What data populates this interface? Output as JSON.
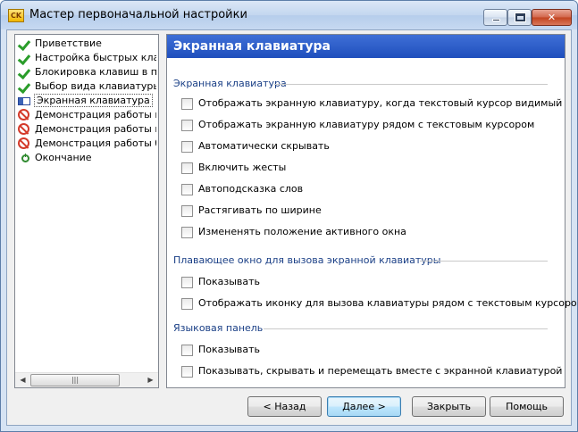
{
  "window": {
    "title": "Мастер первоначальной настройки",
    "icon_text": "CK"
  },
  "nav": {
    "items": [
      {
        "label": "Приветствие",
        "status": "check-icon"
      },
      {
        "label": "Настройка быстрых клавиш",
        "status": "check-icon"
      },
      {
        "label": "Блокировка клавиш в полноэкранных",
        "status": "check-icon"
      },
      {
        "label": "Выбор вида клавиатуры",
        "status": "check-icon"
      },
      {
        "label": "Экранная клавиатура",
        "status": "flag-icon",
        "selected": true
      },
      {
        "label": "Демонстрация работы переключения",
        "status": "no-entry-icon"
      },
      {
        "label": "Демонстрация работы шаблонов",
        "status": "no-entry-icon"
      },
      {
        "label": "Демонстрация работы буфера",
        "status": "no-entry-icon"
      },
      {
        "label": "Окончание",
        "status": "clock-icon"
      }
    ],
    "scroll_grip": "|||"
  },
  "page": {
    "header": "Экранная клавиатура",
    "groups": [
      {
        "title": "Экранная клавиатура",
        "options": [
          "Отображать экранную клавиатуру, когда текстовый курсор видимый",
          "Отображать экранную клавиатуру рядом с текстовым курсором",
          "Автоматически скрывать",
          "Включить жесты",
          "Автоподсказка слов",
          "Растягивать по ширине",
          "Измененять положение активного окна"
        ]
      },
      {
        "title": "Плавающее окно для вызова экранной клавиатуры",
        "options": [
          "Показывать",
          "Отображать иконку для вызова клавиатуры рядом с текстовым курсором"
        ]
      },
      {
        "title": "Языковая панель",
        "options": [
          "Показывать",
          "Показывать, скрывать и перемещать вместе с экранной клавиатурой"
        ]
      }
    ]
  },
  "buttons": {
    "back": "< Назад",
    "next": "Далее >",
    "close": "Закрыть",
    "help": "Помощь"
  }
}
